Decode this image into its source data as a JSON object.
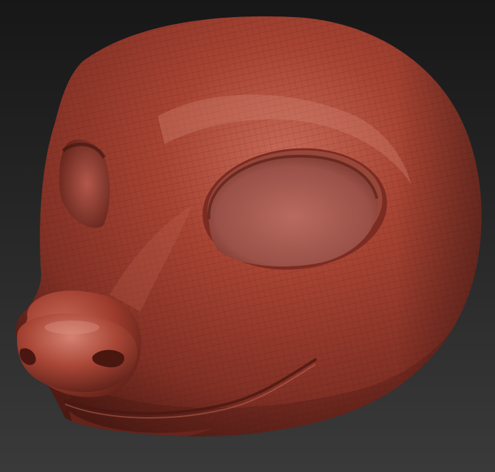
{
  "viewport": {
    "background_top": "#171717",
    "background_bottom": "#3a3a3a"
  },
  "model": {
    "subject": "sculpted-animal-head-mask",
    "base_color": "#9a3a2c",
    "shadow_color": "#4a1a13",
    "highlight_color": "#c96c5c",
    "wireframe_visible": true,
    "eye_openings": 2
  }
}
